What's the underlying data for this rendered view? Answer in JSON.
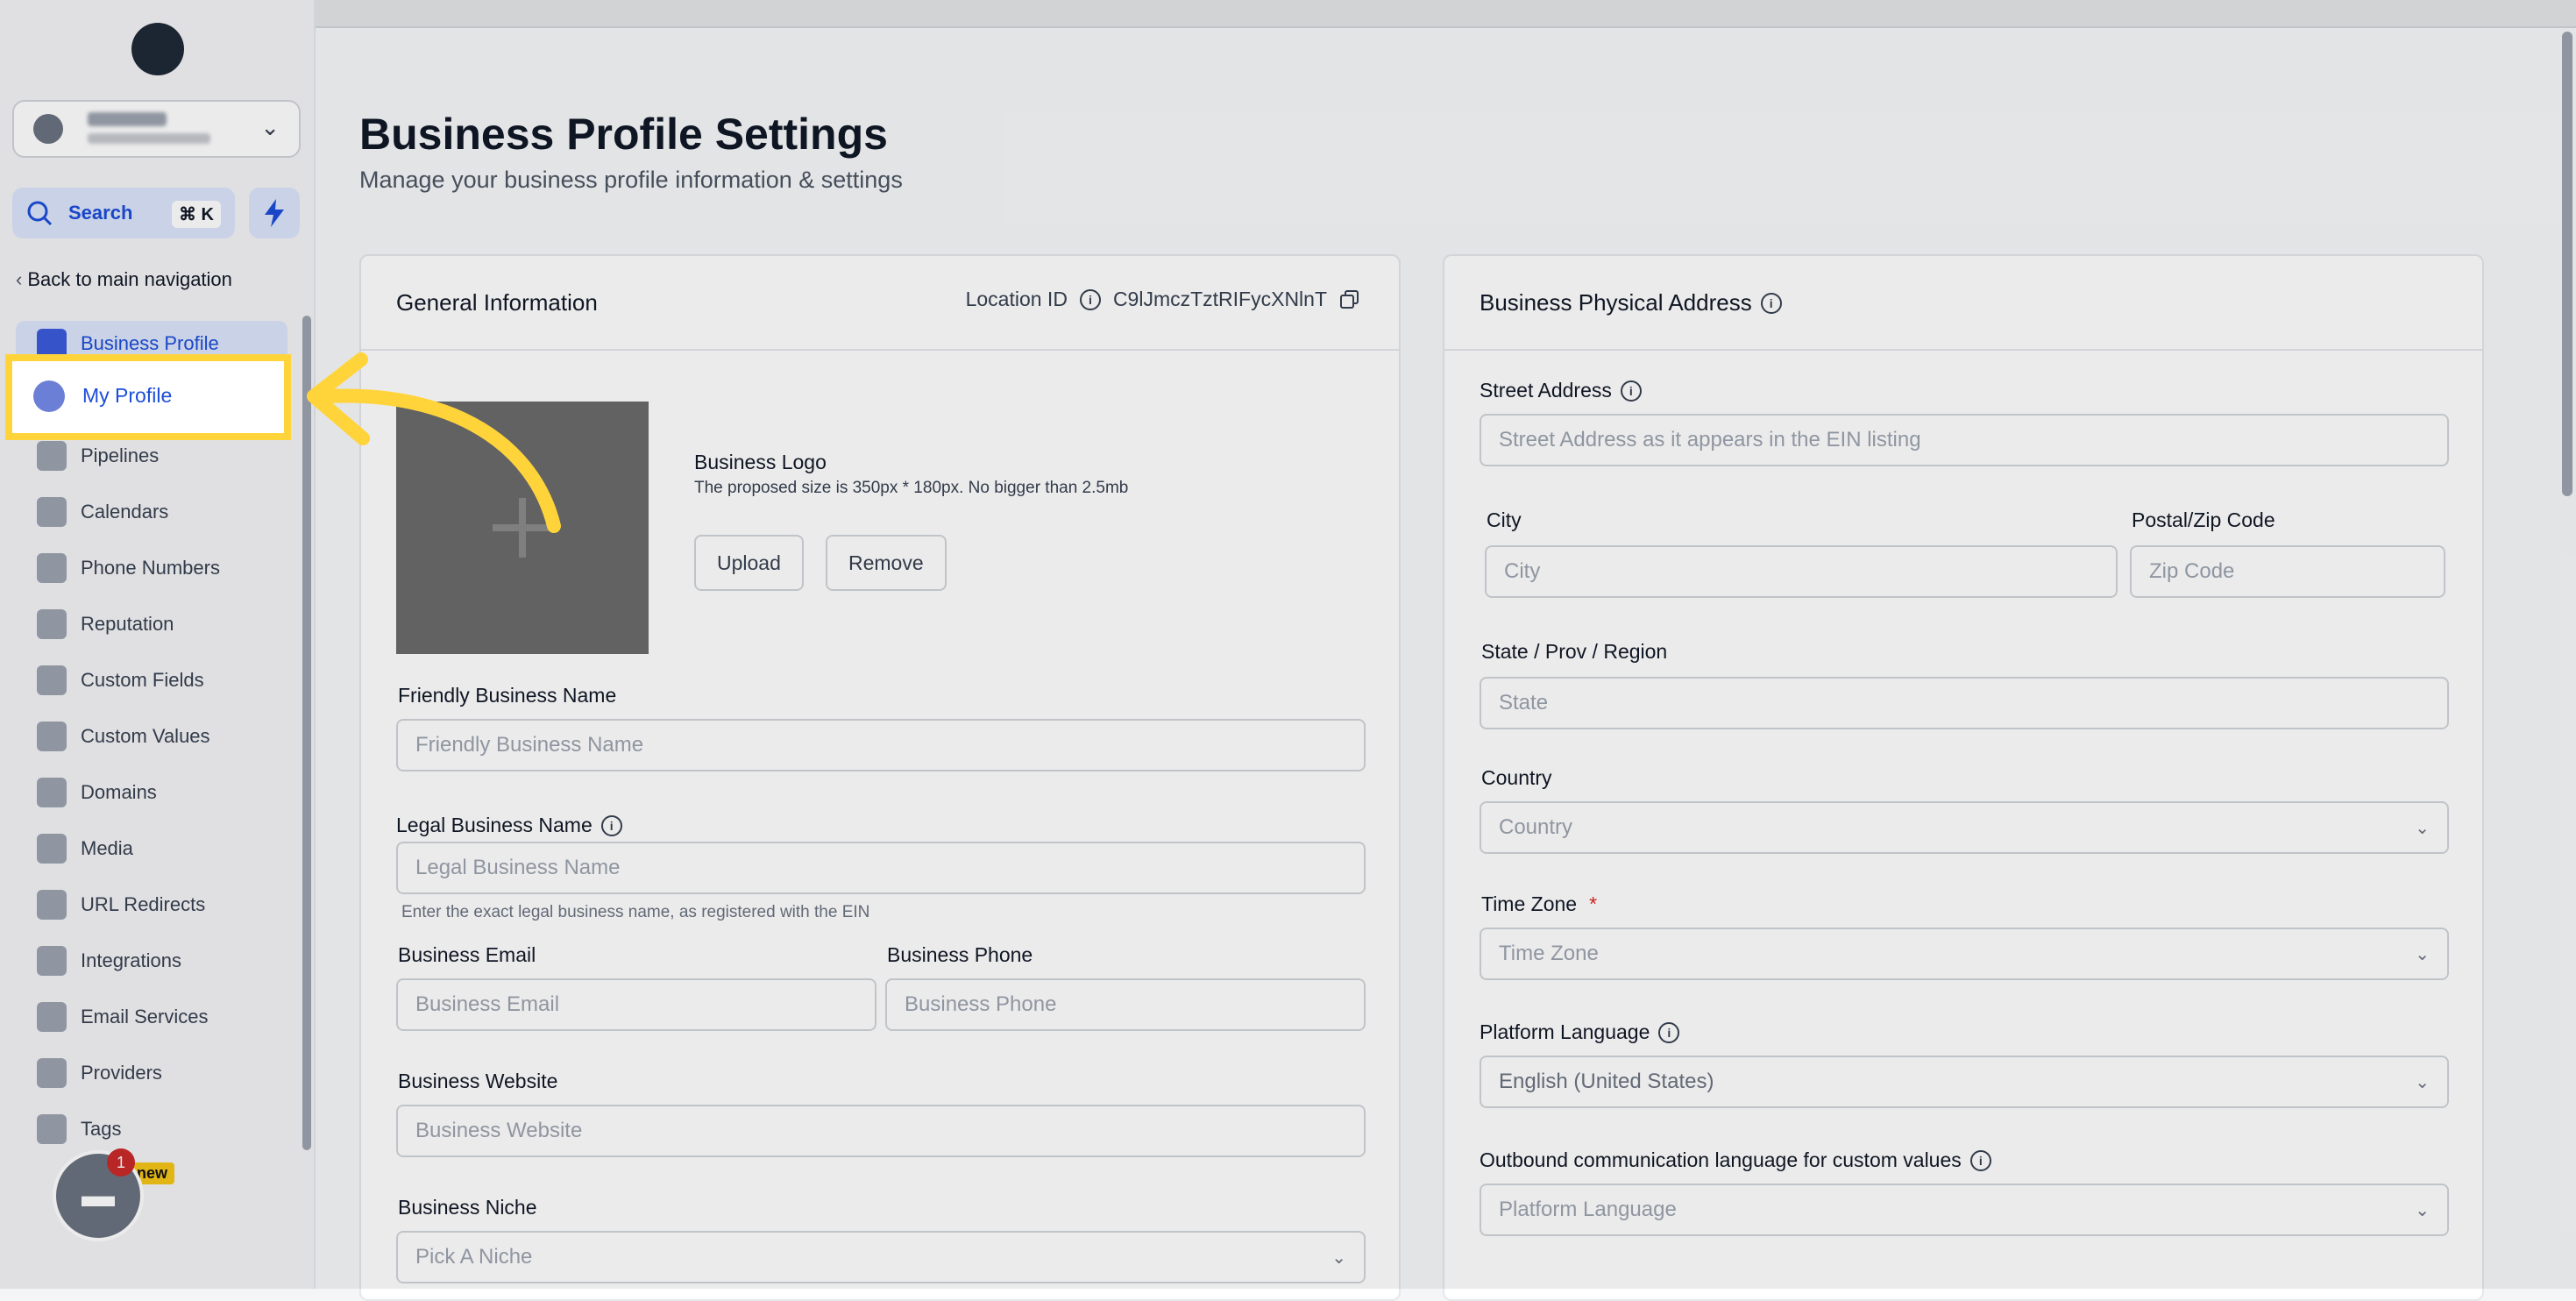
{
  "sidebar": {
    "search": {
      "label": "Search",
      "shortcut": "⌘ K"
    },
    "back_label": "Back to main navigation",
    "items": [
      {
        "label": "Business Profile",
        "icon": "briefcase-icon"
      },
      {
        "label": "My Profile",
        "icon": "user-icon"
      },
      {
        "label": "Pipelines",
        "icon": "funnel-icon"
      },
      {
        "label": "Calendars",
        "icon": "calendar-icon"
      },
      {
        "label": "Phone Numbers",
        "icon": "phone-icon"
      },
      {
        "label": "Reputation",
        "icon": "star-icon"
      },
      {
        "label": "Custom Fields",
        "icon": "fields-icon"
      },
      {
        "label": "Custom Values",
        "icon": "diamond-icon"
      },
      {
        "label": "Domains",
        "icon": "globe-icon"
      },
      {
        "label": "Media",
        "icon": "image-icon"
      },
      {
        "label": "URL Redirects",
        "icon": "redirect-icon"
      },
      {
        "label": "Integrations",
        "icon": "integrations-icon"
      },
      {
        "label": "Email Services",
        "icon": "mail-icon"
      },
      {
        "label": "Providers",
        "icon": "shield-icon"
      },
      {
        "label": "Tags",
        "icon": "tag-icon"
      }
    ],
    "chat_badge_count": "1",
    "new_badge": "new"
  },
  "page": {
    "title": "Business Profile Settings",
    "subtitle": "Manage your business profile information & settings"
  },
  "general": {
    "title": "General Information",
    "location_label": "Location ID",
    "location_id": "C9lJmczTztRIFycXNlnT",
    "logo_title": "Business Logo",
    "logo_hint": "The proposed size is 350px * 180px. No bigger than 2.5mb",
    "upload_label": "Upload",
    "remove_label": "Remove",
    "friendly_name_label": "Friendly Business Name",
    "friendly_name_placeholder": "Friendly Business Name",
    "legal_name_label": "Legal Business Name",
    "legal_name_placeholder": "Legal Business Name",
    "legal_name_hint": "Enter the exact legal business name, as registered with the EIN",
    "email_label": "Business Email",
    "email_placeholder": "Business Email",
    "phone_label": "Business Phone",
    "phone_placeholder": "Business Phone",
    "website_label": "Business Website",
    "website_placeholder": "Business Website",
    "niche_label": "Business Niche",
    "niche_placeholder": "Pick A Niche"
  },
  "address": {
    "title": "Business Physical Address",
    "street_label": "Street Address",
    "street_placeholder": "Street Address as it appears in the EIN listing",
    "city_label": "City",
    "city_placeholder": "City",
    "zip_label": "Postal/Zip Code",
    "zip_placeholder": "Zip Code",
    "state_label": "State / Prov / Region",
    "state_placeholder": "State",
    "country_label": "Country",
    "country_placeholder": "Country",
    "timezone_label": "Time Zone",
    "timezone_required": "*",
    "timezone_placeholder": "Time Zone",
    "platform_lang_label": "Platform Language",
    "platform_lang_value": "English (United States)",
    "outbound_lang_label": "Outbound communication language for custom values",
    "outbound_lang_placeholder": "Platform Language"
  },
  "colors": {
    "accent": "#1d4ed8",
    "highlight": "#ffd43b",
    "active_bg": "#dbe4fb"
  }
}
